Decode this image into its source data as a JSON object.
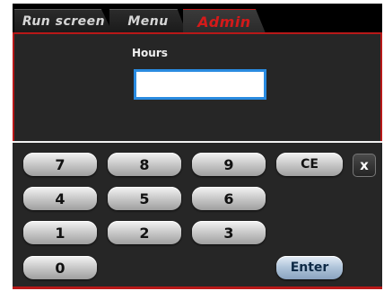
{
  "tabs": [
    {
      "label": "Run screen",
      "active": false
    },
    {
      "label": "Menu",
      "active": false
    },
    {
      "label": "Admin",
      "active": true
    }
  ],
  "form": {
    "hours_label": "Hours",
    "hours_value": ""
  },
  "keypad": {
    "keys": [
      "7",
      "8",
      "9",
      "4",
      "5",
      "6",
      "1",
      "2",
      "3",
      "0"
    ],
    "clear_label": "CE",
    "close_label": "x",
    "enter_label": "Enter"
  },
  "colors": {
    "accent_red": "#b81818",
    "active_tab_text": "#d41a1a",
    "input_focus": "#2a8be0",
    "enter_key": "#aec3d9"
  }
}
